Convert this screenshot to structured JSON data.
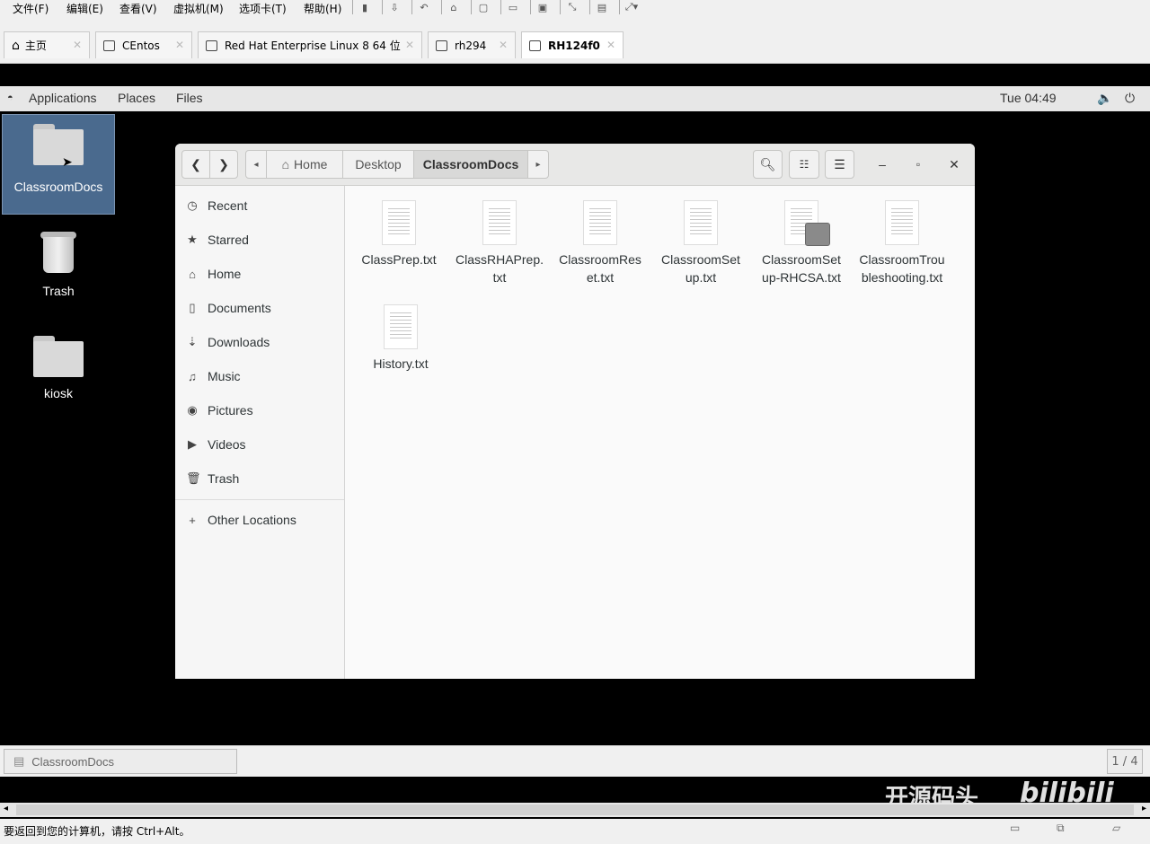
{
  "vm_menu": [
    "文件(F)",
    "编辑(E)",
    "查看(V)",
    "虚拟机(M)",
    "选项卡(T)",
    "帮助(H)"
  ],
  "vm_tabs": [
    {
      "label": "主页"
    },
    {
      "label": "CEntos"
    },
    {
      "label": "Red Hat Enterprise Linux 8 64 位"
    },
    {
      "label": "rh294"
    },
    {
      "label": "RH124f0",
      "active": true
    }
  ],
  "gnome_topbar": {
    "applications": "Applications",
    "places": "Places",
    "files": "Files",
    "clock": "Tue 04:49"
  },
  "desktop_icons": [
    {
      "label": "ClassroomDocs",
      "type": "folder",
      "selected": true
    },
    {
      "label": "Trash",
      "type": "trash"
    },
    {
      "label": "kiosk",
      "type": "home-folder"
    }
  ],
  "file_manager": {
    "breadcrumbs": [
      "Home",
      "Desktop",
      "ClassroomDocs"
    ],
    "sidebar": [
      {
        "label": "Recent",
        "icon": "clock-icon"
      },
      {
        "label": "Starred",
        "icon": "star-icon"
      },
      {
        "label": "Home",
        "icon": "home-icon"
      },
      {
        "label": "Documents",
        "icon": "document-icon"
      },
      {
        "label": "Downloads",
        "icon": "download-icon"
      },
      {
        "label": "Music",
        "icon": "music-icon"
      },
      {
        "label": "Pictures",
        "icon": "camera-icon"
      },
      {
        "label": "Videos",
        "icon": "video-icon"
      },
      {
        "label": "Trash",
        "icon": "trash-icon"
      }
    ],
    "other_locations": "Other Locations",
    "files": [
      {
        "line1": "ClassPrep.txt",
        "line2": ""
      },
      {
        "line1": "ClassRHAPrep.",
        "line2": "txt"
      },
      {
        "line1": "ClassroomRes",
        "line2": "et.txt"
      },
      {
        "line1": "ClassroomSet",
        "line2": "up.txt"
      },
      {
        "line1": "ClassroomSet",
        "line2": "up-RHCSA.txt",
        "locked": true
      },
      {
        "line1": "ClassroomTrou",
        "line2": "bleshooting.txt"
      },
      {
        "line1": "History.txt",
        "line2": ""
      }
    ]
  },
  "vm_status": {
    "task_label": "ClassroomDocs",
    "page_indicator": "1 / 4",
    "hint": "要返回到您的计算机，请按 Ctrl+Alt。"
  },
  "watermark": {
    "text": "开源码头",
    "logo": "bilibili"
  }
}
